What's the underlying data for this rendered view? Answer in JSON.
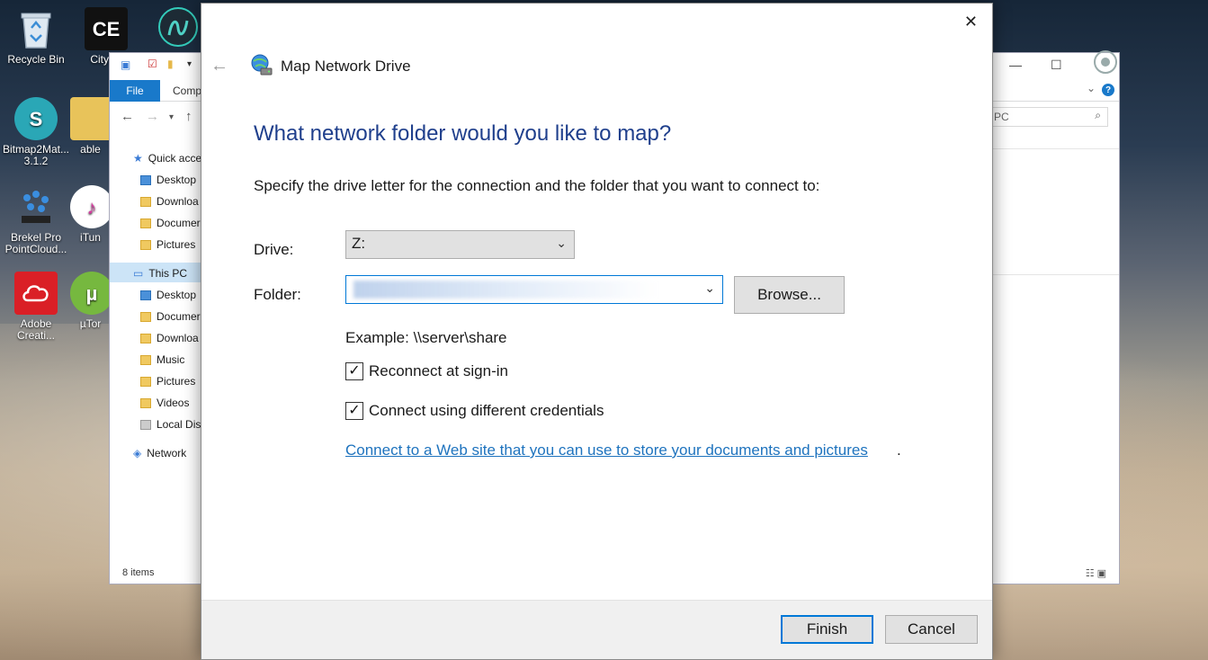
{
  "desktop": {
    "icons": [
      {
        "label": "Recycle Bin"
      },
      {
        "label": "CityEn"
      },
      {
        "label": "Bitmap2Mat... 3.1.2"
      },
      {
        "label": "able"
      },
      {
        "label": "Brekel Pro PointCloud..."
      },
      {
        "label": "iTun"
      },
      {
        "label": "Adobe Creati..."
      },
      {
        "label": "µTor"
      }
    ],
    "ce_logo": "CE"
  },
  "explorer": {
    "file_tab": "File",
    "computer_tab": "Comp",
    "search_placeholder": "PC",
    "help": "?",
    "status": "8 items",
    "pane": {
      "quick_access": "Quick acce",
      "quick_items": [
        "Desktop",
        "Downloa",
        "Documer",
        "Pictures"
      ],
      "this_pc": "This PC",
      "pc_items": [
        "Desktop",
        "Documer",
        "Downloa",
        "Music",
        "Pictures",
        "Videos",
        "Local Disl"
      ],
      "network": "Network"
    }
  },
  "dialog": {
    "title": "Map Network Drive",
    "heading": "What network folder would you like to map?",
    "instruction": "Specify the drive letter for the connection and the folder that you want to connect to:",
    "drive_label": "Drive:",
    "drive_value": "Z:",
    "folder_label": "Folder:",
    "browse_label": "Browse...",
    "example": "Example: \\\\server\\share",
    "reconnect_label": "Reconnect at sign-in",
    "reconnect_checked": true,
    "credentials_label": "Connect using different credentials",
    "credentials_checked": true,
    "web_link": "Connect to a Web site that you can use to store your documents and pictures",
    "web_link_suffix": ".",
    "finish_label": "Finish",
    "cancel_label": "Cancel"
  }
}
